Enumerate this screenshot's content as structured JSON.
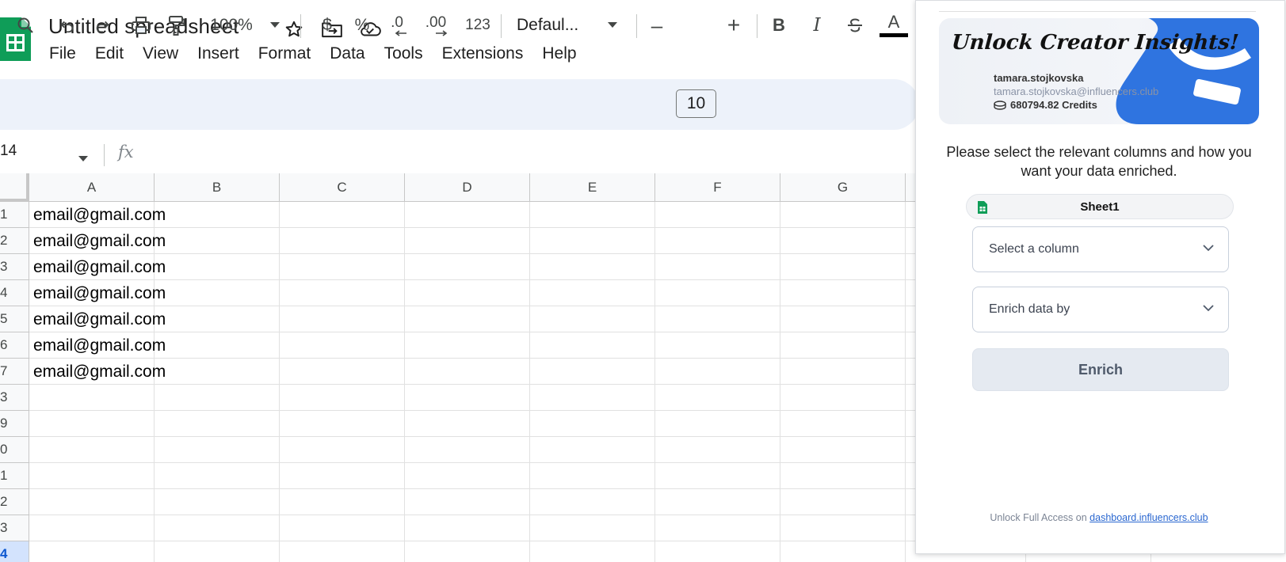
{
  "document": {
    "title": "Untitled spreadsheet"
  },
  "menu": [
    "File",
    "Edit",
    "View",
    "Insert",
    "Format",
    "Data",
    "Tools",
    "Extensions",
    "Help"
  ],
  "toolbar": {
    "zoom": "100%",
    "currency": "$",
    "percent": "%",
    "decrease_decimal": ".0",
    "increase_decimal": ".00",
    "number_format": "123",
    "font": "Defaul...",
    "font_size": "10",
    "minus": "–",
    "plus": "+",
    "bold": "B",
    "italic": "I",
    "text_color": "A"
  },
  "formula_bar": {
    "name_box": "14",
    "fx": "fx"
  },
  "grid": {
    "columns": [
      "A",
      "B",
      "C",
      "D",
      "E",
      "F",
      "G"
    ],
    "row_labels": [
      "1",
      "2",
      "3",
      "4",
      "5",
      "6",
      "7",
      "3",
      "9",
      "0",
      "1",
      "2",
      "3",
      "4"
    ],
    "active_row_index": 13,
    "cells_col_a": [
      "email@gmail.com",
      "email@gmail.com",
      "email@gmail.com",
      "email@gmail.com",
      "email@gmail.com",
      "email@gmail.com",
      "email@gmail.com"
    ]
  },
  "panel": {
    "banner_title": "Unlock Creator Insights!",
    "username": "tamara.stojkovska",
    "email": "tamara.stojkovska@influencers.club",
    "credits": "680794.82 Credits",
    "instructions": "Please select the relevant columns and how you want your data enriched.",
    "sheet_name": "Sheet1",
    "select_column_placeholder": "Select a column",
    "enrich_by_placeholder": "Enrich data by",
    "enrich_button": "Enrich",
    "footer_text": "Unlock Full Access on",
    "footer_link": "dashboard.influencers.club"
  },
  "colors": {
    "sheets_green": "#0f9d58",
    "toolbar_bg": "#edf2fa",
    "banner_blue": "#2f74e0",
    "active_row": "#d3e3fd",
    "button_bg": "#e5eaf1"
  }
}
